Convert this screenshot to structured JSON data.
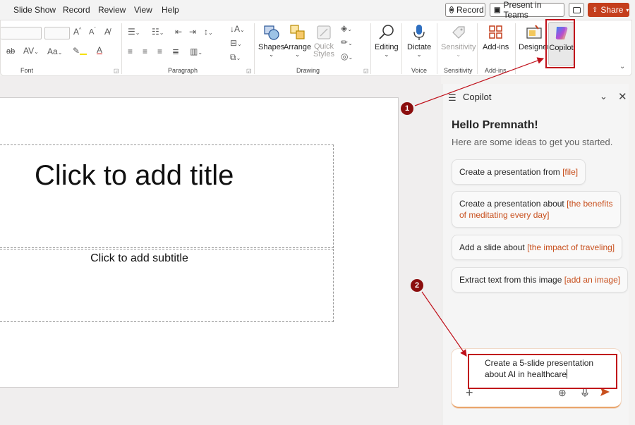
{
  "menu": [
    "Slide Show",
    "Record",
    "Review",
    "View",
    "Help"
  ],
  "header_buttons": {
    "record": "Record",
    "present_teams": "Present in Teams",
    "share": "Share"
  },
  "ribbon": {
    "groups": {
      "font": "Font",
      "paragraph": "Paragraph",
      "drawing": "Drawing",
      "voice": "Voice",
      "sensitivity": "Sensitivity",
      "addins": "Add-ins"
    },
    "buttons": {
      "shapes": "Shapes",
      "arrange": "Arrange",
      "quick_styles_1": "Quick",
      "quick_styles_2": "Styles",
      "editing": "Editing",
      "dictate": "Dictate",
      "sensitivity": "Sensitivity",
      "addins": "Add-ins",
      "designer": "Designer",
      "copilot": "Copilot"
    }
  },
  "slide": {
    "title_placeholder": "Click to add title",
    "subtitle_placeholder": "Click to add subtitle"
  },
  "copilot": {
    "title": "Copilot",
    "greeting": "Hello Premnath!",
    "intro": "Here are some ideas to get you started.",
    "suggestions": [
      {
        "text": "Create a presentation from ",
        "highlight": "[file]"
      },
      {
        "text": "Create a presentation about ",
        "highlight": "[the benefits of meditating every day]"
      },
      {
        "text": "Add a slide about ",
        "highlight": "[the impact of traveling]"
      },
      {
        "text": "Extract text from this image ",
        "highlight": "[add an image]"
      }
    ],
    "prompt_value": "Create a 5-slide presentation about AI in healthcare"
  },
  "annotations": {
    "callout_1": "1",
    "callout_2": "2",
    "color": "#c0101a"
  },
  "colors": {
    "accent": "#c43e1c",
    "highlight": "#c8501e"
  }
}
